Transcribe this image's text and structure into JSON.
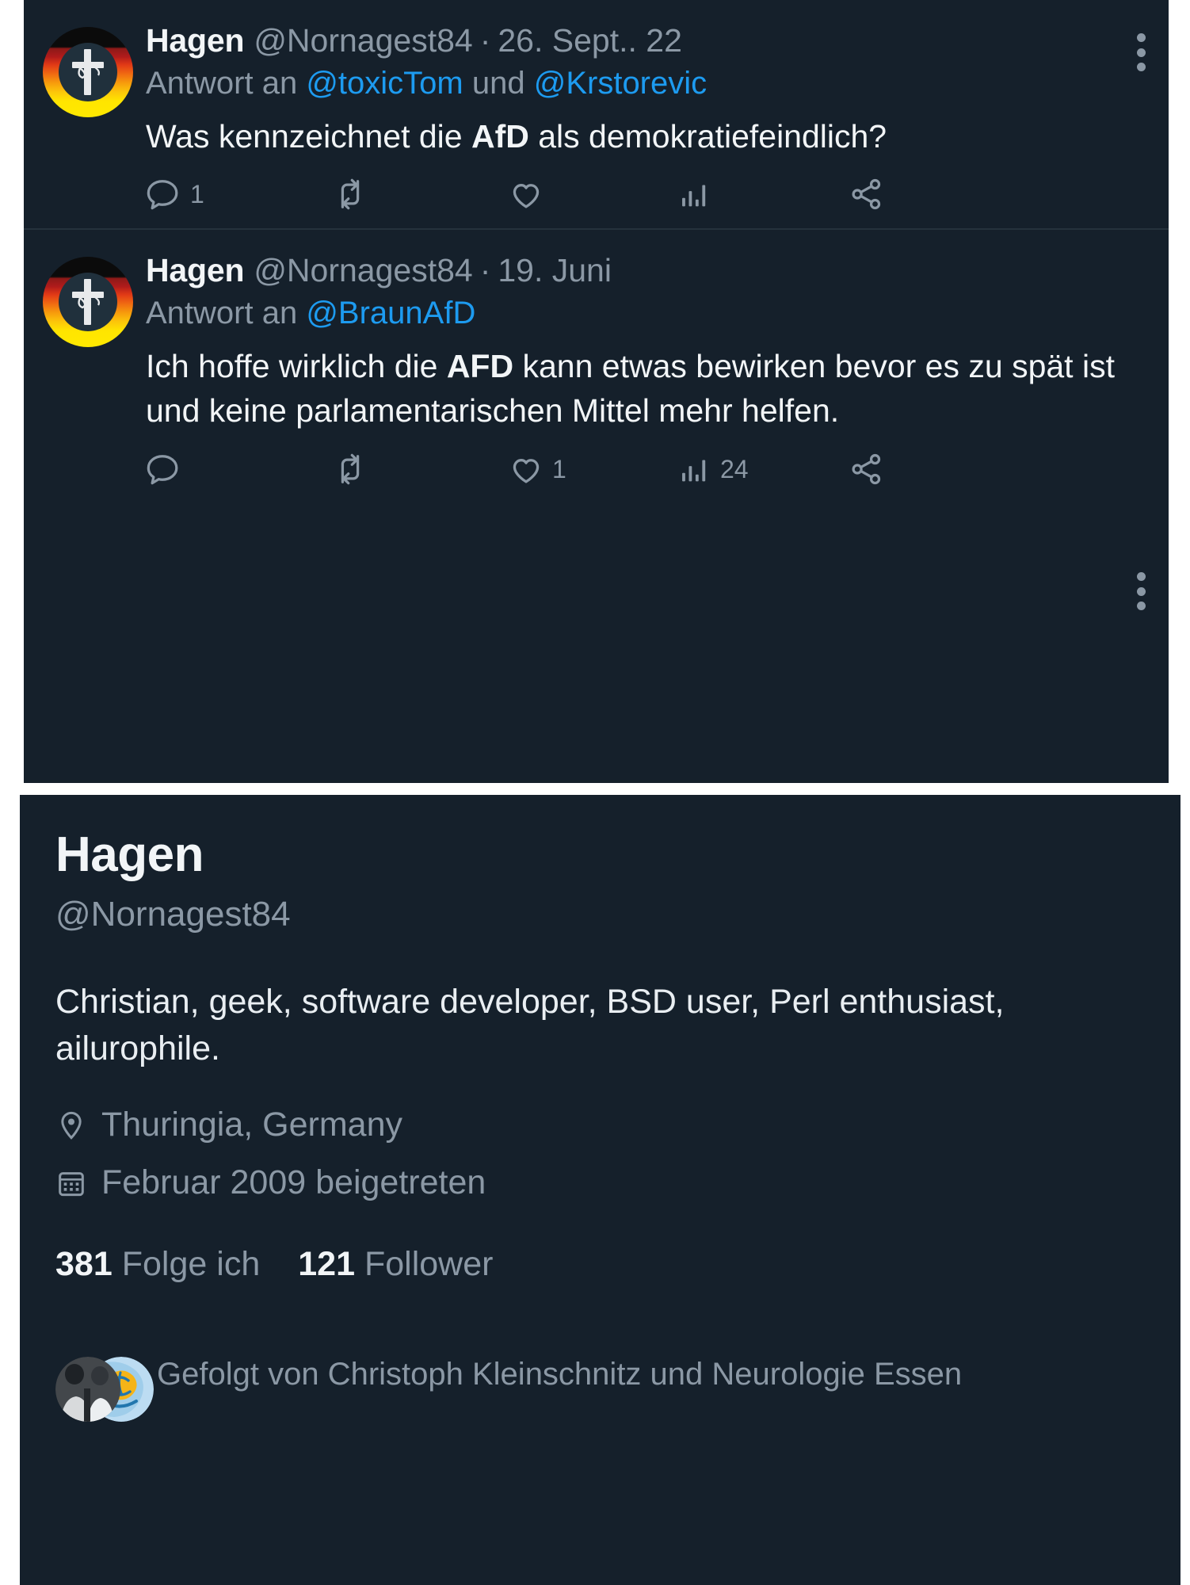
{
  "theme": {
    "background": "#15202b",
    "page_background": "#ffffff",
    "text_primary": "#f2f5f7",
    "text_secondary": "#8b98a5",
    "link": "#1d9bf0",
    "divider": "#25323c"
  },
  "timeline": {
    "tweets": [
      {
        "display_name": "Hagen",
        "handle": "@Nornagest84",
        "separator": "·",
        "date": "26. Sept.. 22",
        "reply_prefix": "Antwort an ",
        "reply_mentions": [
          "@toxicTom",
          "@Krstorevic"
        ],
        "reply_conjunction": " und ",
        "text_parts": [
          {
            "text": "Was kennzeichnet die ",
            "bold": false
          },
          {
            "text": "AfD",
            "bold": true
          },
          {
            "text": " als demokratiefeindlich?",
            "bold": false
          }
        ],
        "text_plain": "Was kennzeichnet die AfD als demokratiefeindlich?",
        "actions": {
          "reply_count": "1",
          "retweet_count": "",
          "like_count": "",
          "views_count": ""
        }
      },
      {
        "display_name": "Hagen",
        "handle": "@Nornagest84",
        "separator": "·",
        "date": "19. Juni",
        "reply_prefix": "Antwort an ",
        "reply_mentions": [
          "@BraunAfD"
        ],
        "reply_conjunction": "",
        "text_parts": [
          {
            "text": "Ich hoffe wirklich die ",
            "bold": false
          },
          {
            "text": "AFD",
            "bold": true
          },
          {
            "text": " kann etwas bewirken bevor es zu spät ist und keine parlamentarischen Mittel mehr helfen.",
            "bold": false
          }
        ],
        "text_plain": "Ich hoffe wirklich die AFD kann etwas bewirken bevor es zu spät ist und keine parlamentarischen Mittel mehr helfen.",
        "actions": {
          "reply_count": "",
          "retweet_count": "",
          "like_count": "1",
          "views_count": "24"
        }
      }
    ]
  },
  "profile": {
    "name": "Hagen",
    "handle": "@Nornagest84",
    "bio": "Christian, geek, software developer, BSD user, Perl enthusiast, ailurophile.",
    "location": "Thuringia, Germany",
    "joined": "Februar 2009 beigetreten",
    "following_count": "381",
    "following_label": "Folge ich",
    "followers_count": "121",
    "followers_label": "Follower",
    "followed_by": "Gefolgt von Christoph Kleinschnitz und Neurologie Essen"
  },
  "icons": {
    "avatar": "german-flag-cross-avatar",
    "more": "more-options-icon",
    "reply": "reply-icon",
    "retweet": "retweet-icon",
    "like": "heart-icon",
    "views": "analytics-bars-icon",
    "share": "share-icon",
    "location": "location-pin-icon",
    "calendar": "calendar-icon"
  }
}
